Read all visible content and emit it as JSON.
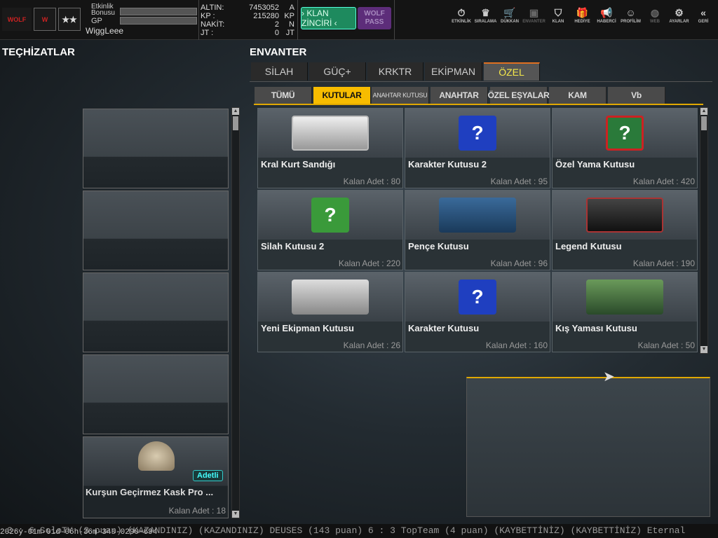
{
  "player": {
    "name": "WiggLeee",
    "event_bonus_label": "Etkinlik Bonusu",
    "gp_label": "GP",
    "rank_icon": "two-stars"
  },
  "currency": [
    {
      "label": "ALTIN:",
      "value": "7453052",
      "unit": "A"
    },
    {
      "label": "KP :",
      "value": "215280",
      "unit": "KP"
    },
    {
      "label": "NAKİT:",
      "value": "2",
      "unit": "N"
    },
    {
      "label": "JT :",
      "value": "0",
      "unit": "JT"
    }
  ],
  "buttons": {
    "klan_zinciri": "› KLAN ZİNCİRİ ‹",
    "wolf_pass": "WOLF PASS",
    "logo": "WOLF DIRILIS"
  },
  "nav": [
    {
      "label": "ETKİNLİK",
      "icon": "⏱"
    },
    {
      "label": "SIRALAMA",
      "icon": "♛"
    },
    {
      "label": "DÜKKAN",
      "icon": "🛒"
    },
    {
      "label": "ENVANTER",
      "icon": "▣"
    },
    {
      "label": "KLAN",
      "icon": "⛉"
    },
    {
      "label": "HEDİYE",
      "icon": "🎁"
    },
    {
      "label": "HABERCİ",
      "icon": "📢"
    },
    {
      "label": "PROFİLİM",
      "icon": "☺"
    },
    {
      "label": "WEB",
      "icon": "◍"
    },
    {
      "label": "AYARLAR",
      "icon": "⚙"
    },
    {
      "label": "GERİ",
      "icon": "«"
    }
  ],
  "left": {
    "title": "TEÇHİZATLAR",
    "equipped": {
      "name": "Kurşun Geçirmez Kask Pro ...",
      "badge": "Adetli",
      "count": "Kalan Adet : 18"
    }
  },
  "inventory": {
    "title": "ENVANTER",
    "tabs": [
      "SİLAH",
      "GÜÇ+",
      "KRKTR",
      "EKİPMAN",
      "ÖZEL"
    ],
    "subtabs": [
      "TÜMÜ",
      "KUTULAR",
      "ANAHTAR KUTUSU",
      "ANAHTAR",
      "ÖZEL EŞYALAR",
      "KAM",
      "Vb"
    ],
    "items": [
      {
        "name": "Kral Kurt Sandığı",
        "count": "Kalan Adet : 80"
      },
      {
        "name": "Karakter Kutusu 2",
        "count": "Kalan Adet : 95"
      },
      {
        "name": "Özel Yama Kutusu",
        "count": "Kalan Adet : 420"
      },
      {
        "name": "Silah Kutusu 2",
        "count": "Kalan Adet : 220"
      },
      {
        "name": "Pençe Kutusu",
        "count": "Kalan Adet : 96"
      },
      {
        "name": "Legend Kutusu",
        "count": "Kalan Adet : 190"
      },
      {
        "name": "Yeni Ekipman Kutusu",
        "count": "Kalan Adet : 26"
      },
      {
        "name": "Karakter Kutusu",
        "count": "Kalan Adet : 160"
      },
      {
        "name": "Kış Yaması Kutusu",
        "count": "Kalan Adet : 50"
      }
    ]
  },
  "ticker": {
    "timestamp": "2026y-01m-01d-06h-36m-34s-0290-694",
    "text": "3 : 6 SoloTY (3 puan) (KAZANDINIZ)      (KAZANDINIZ) DEUSES (143 puan) 6 : 3 TopTeam (4 puan) (KAYBETTİNİZ)      (KAYBETTİNİZ) Eternal"
  }
}
